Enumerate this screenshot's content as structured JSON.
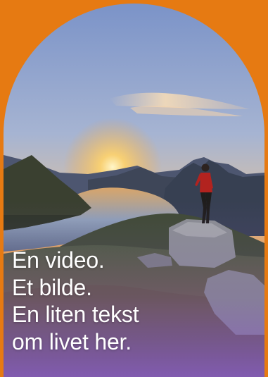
{
  "caption": {
    "line1": "En video.",
    "line2": "Et bilde.",
    "line3": "En liten tekst",
    "line4": "om livet her."
  },
  "colors": {
    "background": "#e67a12",
    "overlay_bottom": "#8a5fc4",
    "text": "#ffffff"
  },
  "image": {
    "subject": "person-on-rock-at-sunset-icon"
  }
}
